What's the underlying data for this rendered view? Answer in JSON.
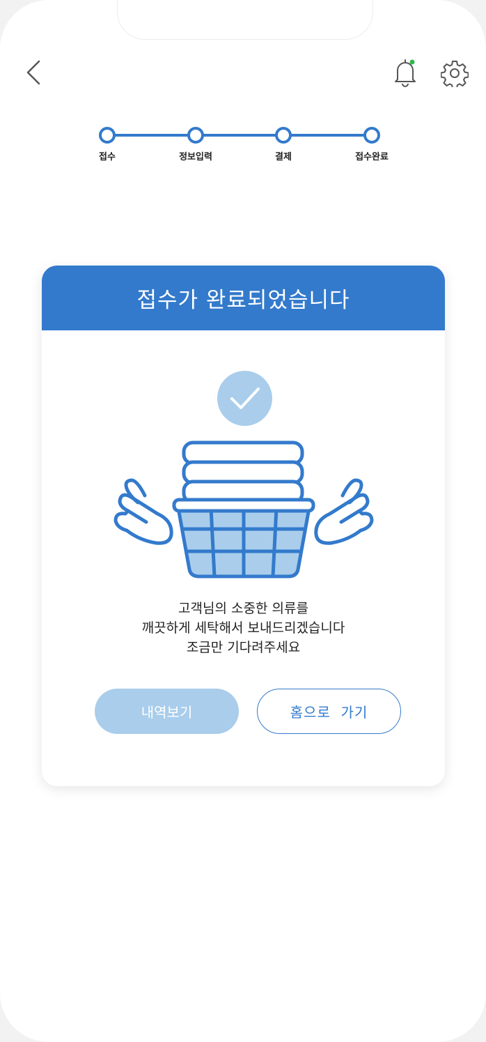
{
  "colors": {
    "primary": "#337acc",
    "light_blue": "#a9cdeb",
    "notification_dot": "#2eb84d",
    "text": "#222222"
  },
  "header": {
    "back_icon": "chevron-left-icon",
    "notification_icon": "bell-icon",
    "settings_icon": "gear-icon"
  },
  "stepper": {
    "steps": [
      {
        "label": "접수"
      },
      {
        "label": "정보입력"
      },
      {
        "label": "결제"
      },
      {
        "label": "접수완료"
      }
    ]
  },
  "card": {
    "title": "접수가 완료되었습니다",
    "status_icon": "check-icon",
    "illustration": "laundry-basket-with-hands",
    "message_lines": [
      "고객님의 소중한 의류를",
      "깨끗하게 세탁해서 보내드리겠습니다",
      "조금만 기다려주세요"
    ],
    "buttons": {
      "history": "내역보기",
      "home": "홈으로  가기"
    }
  }
}
